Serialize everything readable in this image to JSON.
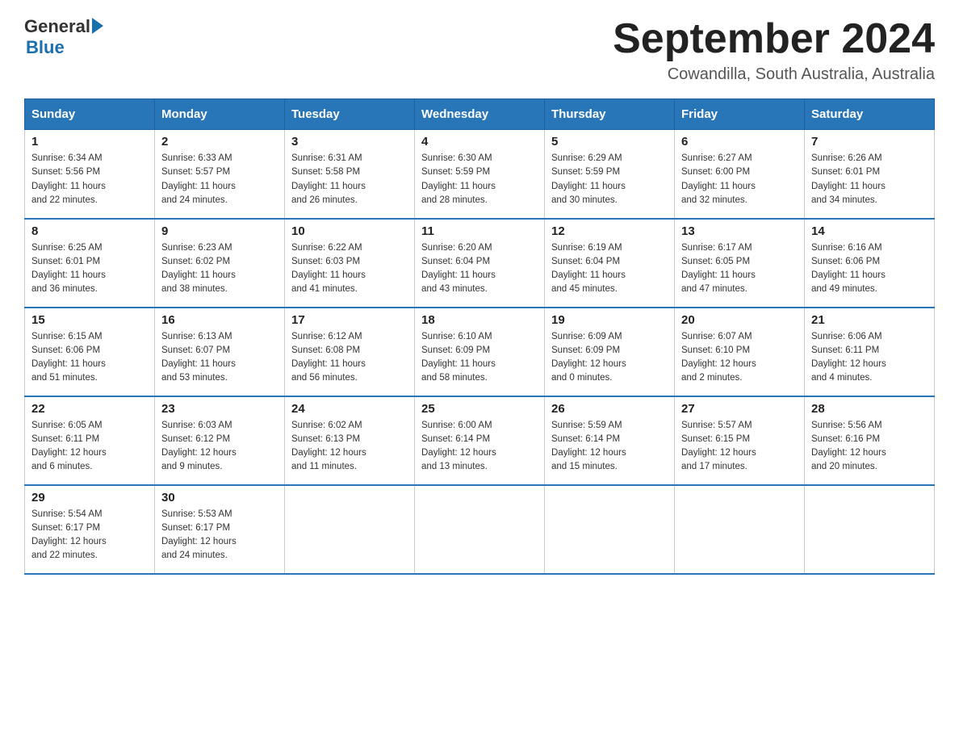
{
  "header": {
    "logo_general": "General",
    "logo_blue": "Blue",
    "title": "September 2024",
    "location": "Cowandilla, South Australia, Australia"
  },
  "days_of_week": [
    "Sunday",
    "Monday",
    "Tuesday",
    "Wednesday",
    "Thursday",
    "Friday",
    "Saturday"
  ],
  "weeks": [
    [
      {
        "day": "1",
        "sunrise": "6:34 AM",
        "sunset": "5:56 PM",
        "daylight": "11 hours and 22 minutes."
      },
      {
        "day": "2",
        "sunrise": "6:33 AM",
        "sunset": "5:57 PM",
        "daylight": "11 hours and 24 minutes."
      },
      {
        "day": "3",
        "sunrise": "6:31 AM",
        "sunset": "5:58 PM",
        "daylight": "11 hours and 26 minutes."
      },
      {
        "day": "4",
        "sunrise": "6:30 AM",
        "sunset": "5:59 PM",
        "daylight": "11 hours and 28 minutes."
      },
      {
        "day": "5",
        "sunrise": "6:29 AM",
        "sunset": "5:59 PM",
        "daylight": "11 hours and 30 minutes."
      },
      {
        "day": "6",
        "sunrise": "6:27 AM",
        "sunset": "6:00 PM",
        "daylight": "11 hours and 32 minutes."
      },
      {
        "day": "7",
        "sunrise": "6:26 AM",
        "sunset": "6:01 PM",
        "daylight": "11 hours and 34 minutes."
      }
    ],
    [
      {
        "day": "8",
        "sunrise": "6:25 AM",
        "sunset": "6:01 PM",
        "daylight": "11 hours and 36 minutes."
      },
      {
        "day": "9",
        "sunrise": "6:23 AM",
        "sunset": "6:02 PM",
        "daylight": "11 hours and 38 minutes."
      },
      {
        "day": "10",
        "sunrise": "6:22 AM",
        "sunset": "6:03 PM",
        "daylight": "11 hours and 41 minutes."
      },
      {
        "day": "11",
        "sunrise": "6:20 AM",
        "sunset": "6:04 PM",
        "daylight": "11 hours and 43 minutes."
      },
      {
        "day": "12",
        "sunrise": "6:19 AM",
        "sunset": "6:04 PM",
        "daylight": "11 hours and 45 minutes."
      },
      {
        "day": "13",
        "sunrise": "6:17 AM",
        "sunset": "6:05 PM",
        "daylight": "11 hours and 47 minutes."
      },
      {
        "day": "14",
        "sunrise": "6:16 AM",
        "sunset": "6:06 PM",
        "daylight": "11 hours and 49 minutes."
      }
    ],
    [
      {
        "day": "15",
        "sunrise": "6:15 AM",
        "sunset": "6:06 PM",
        "daylight": "11 hours and 51 minutes."
      },
      {
        "day": "16",
        "sunrise": "6:13 AM",
        "sunset": "6:07 PM",
        "daylight": "11 hours and 53 minutes."
      },
      {
        "day": "17",
        "sunrise": "6:12 AM",
        "sunset": "6:08 PM",
        "daylight": "11 hours and 56 minutes."
      },
      {
        "day": "18",
        "sunrise": "6:10 AM",
        "sunset": "6:09 PM",
        "daylight": "11 hours and 58 minutes."
      },
      {
        "day": "19",
        "sunrise": "6:09 AM",
        "sunset": "6:09 PM",
        "daylight": "12 hours and 0 minutes."
      },
      {
        "day": "20",
        "sunrise": "6:07 AM",
        "sunset": "6:10 PM",
        "daylight": "12 hours and 2 minutes."
      },
      {
        "day": "21",
        "sunrise": "6:06 AM",
        "sunset": "6:11 PM",
        "daylight": "12 hours and 4 minutes."
      }
    ],
    [
      {
        "day": "22",
        "sunrise": "6:05 AM",
        "sunset": "6:11 PM",
        "daylight": "12 hours and 6 minutes."
      },
      {
        "day": "23",
        "sunrise": "6:03 AM",
        "sunset": "6:12 PM",
        "daylight": "12 hours and 9 minutes."
      },
      {
        "day": "24",
        "sunrise": "6:02 AM",
        "sunset": "6:13 PM",
        "daylight": "12 hours and 11 minutes."
      },
      {
        "day": "25",
        "sunrise": "6:00 AM",
        "sunset": "6:14 PM",
        "daylight": "12 hours and 13 minutes."
      },
      {
        "day": "26",
        "sunrise": "5:59 AM",
        "sunset": "6:14 PM",
        "daylight": "12 hours and 15 minutes."
      },
      {
        "day": "27",
        "sunrise": "5:57 AM",
        "sunset": "6:15 PM",
        "daylight": "12 hours and 17 minutes."
      },
      {
        "day": "28",
        "sunrise": "5:56 AM",
        "sunset": "6:16 PM",
        "daylight": "12 hours and 20 minutes."
      }
    ],
    [
      {
        "day": "29",
        "sunrise": "5:54 AM",
        "sunset": "6:17 PM",
        "daylight": "12 hours and 22 minutes."
      },
      {
        "day": "30",
        "sunrise": "5:53 AM",
        "sunset": "6:17 PM",
        "daylight": "12 hours and 24 minutes."
      },
      null,
      null,
      null,
      null,
      null
    ]
  ],
  "labels": {
    "sunrise_prefix": "Sunrise: ",
    "sunset_prefix": "Sunset: ",
    "daylight_prefix": "Daylight: "
  }
}
